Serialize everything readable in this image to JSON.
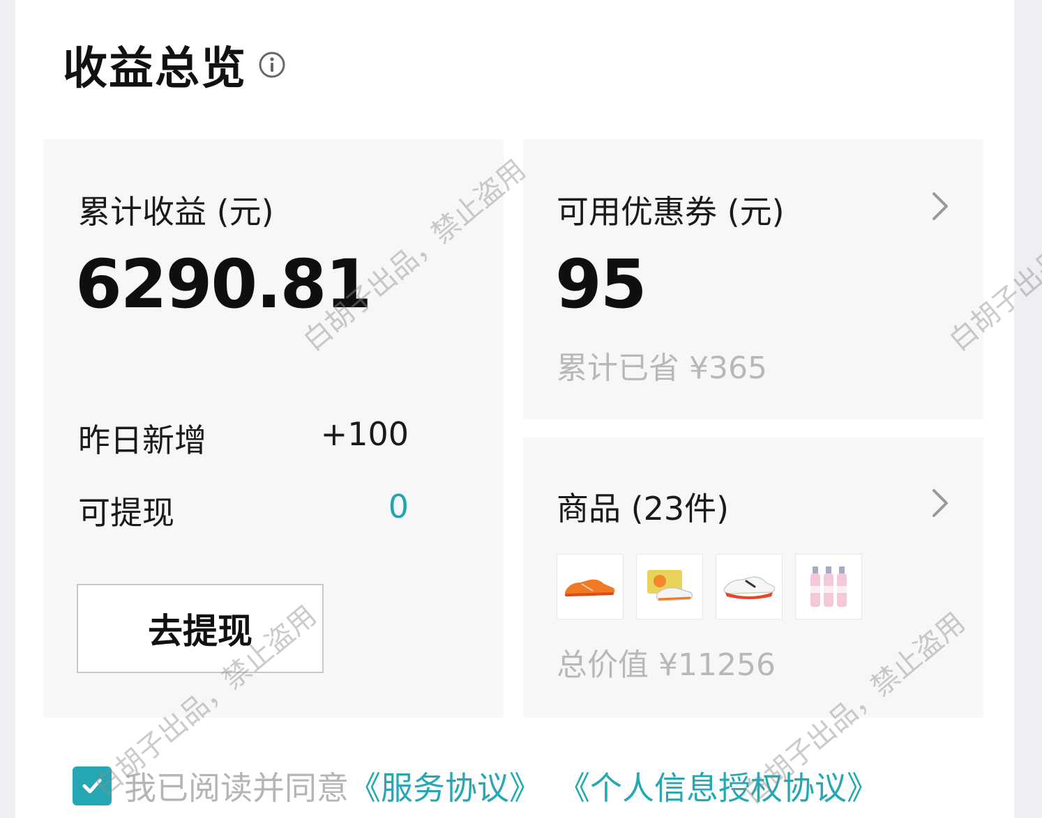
{
  "header": {
    "title": "收益总览",
    "info_icon": "info-circle-icon"
  },
  "earnings": {
    "label": "累计收益 (元)",
    "total": "6290.81",
    "yesterday_label": "昨日新增",
    "yesterday_value": "+100",
    "withdrawable_label": "可提现",
    "withdrawable_value": "0",
    "withdraw_button": "去提现"
  },
  "coupons": {
    "label": "可用优惠券 (元)",
    "amount": "95",
    "saved": "累计已省 ¥365",
    "chevron_icon": "chevron-right-icon"
  },
  "goods": {
    "label": "商品 (23件)",
    "total_value": "总价值 ¥11256",
    "chevron_icon": "chevron-right-icon",
    "thumbnails": [
      {
        "icon": "orange-running-shoe-icon"
      },
      {
        "icon": "shoe-box-icon"
      },
      {
        "icon": "white-red-running-shoe-icon"
      },
      {
        "icon": "pink-bottles-icon"
      }
    ]
  },
  "agreement": {
    "checked": true,
    "text": "我已阅读并同意",
    "service_link": "《服务协议》",
    "privacy_link": "《个人信息授权协议》"
  },
  "watermark": {
    "text": "白胡子出品，禁止盗用"
  },
  "colors": {
    "accent": "#26a8b4",
    "card_bg": "#f7f7f9",
    "muted_text": "#b8b8b8"
  }
}
